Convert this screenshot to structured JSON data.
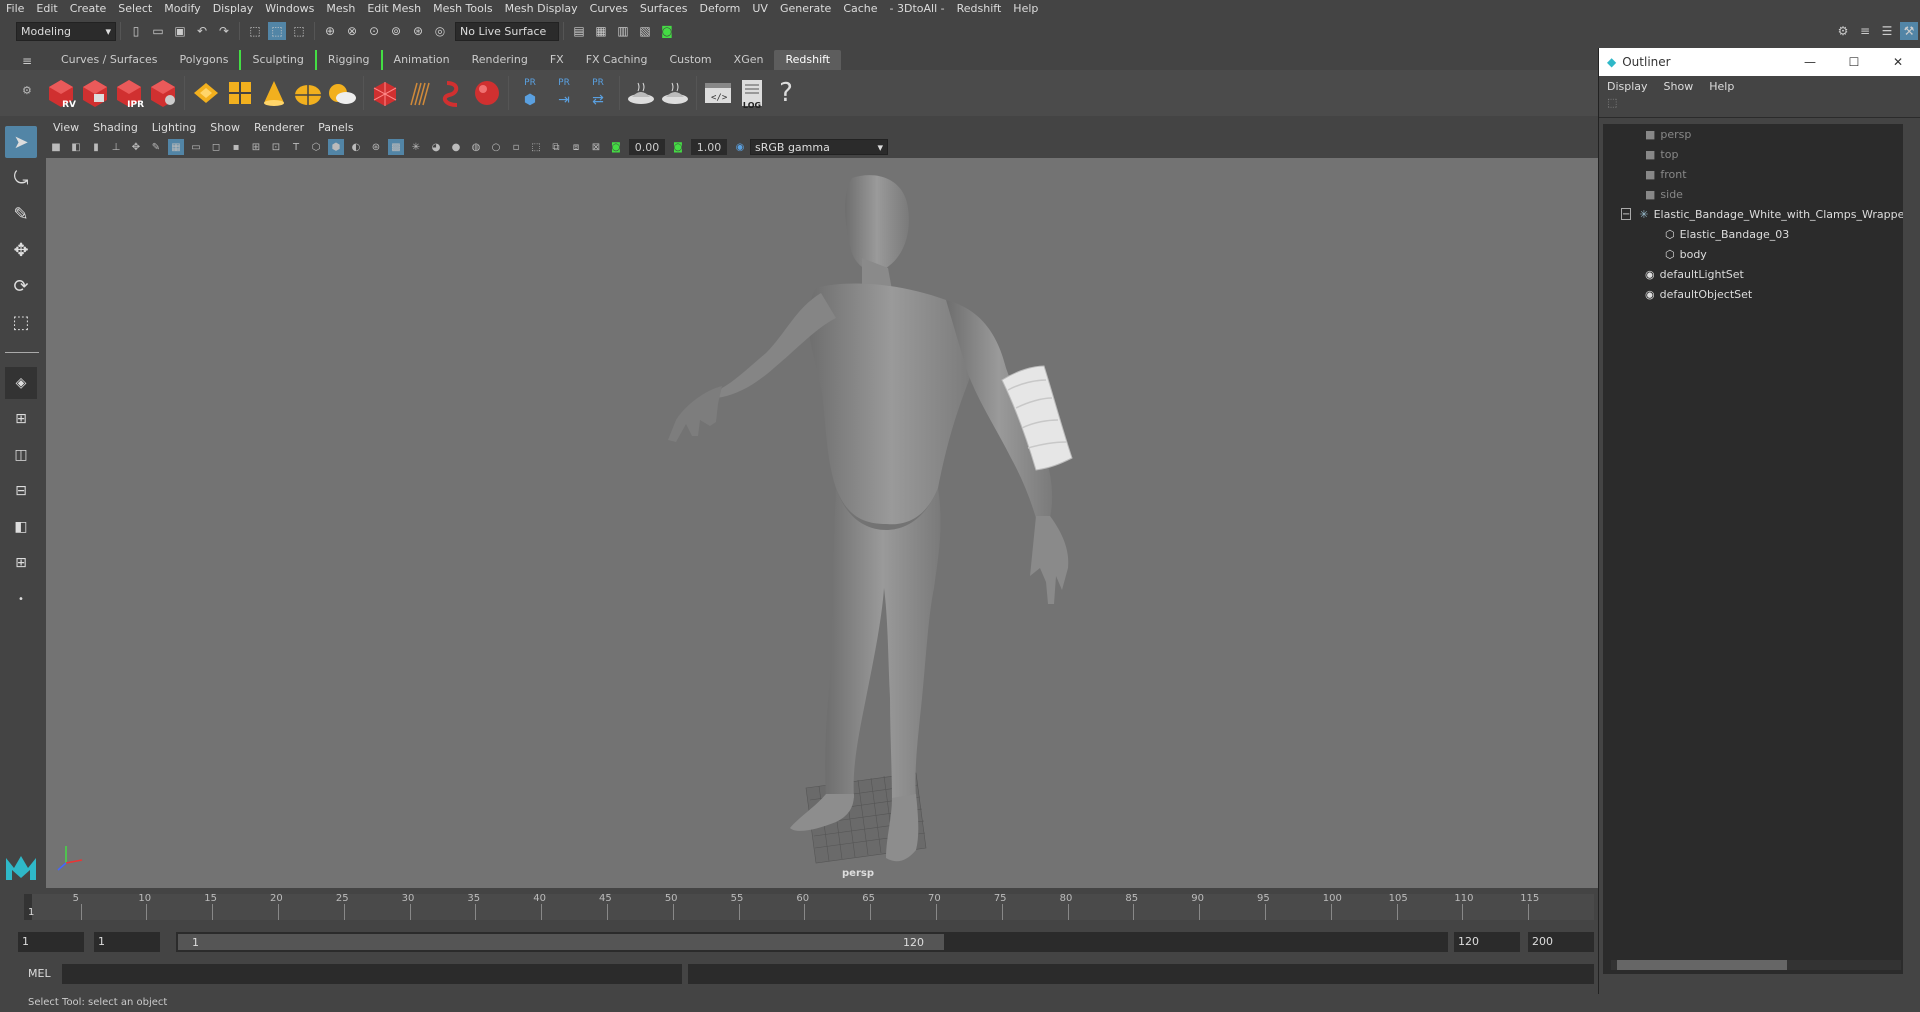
{
  "menubar": {
    "items": [
      "File",
      "Edit",
      "Create",
      "Select",
      "Modify",
      "Display",
      "Windows",
      "Mesh",
      "Edit Mesh",
      "Mesh Tools",
      "Mesh Display",
      "Curves",
      "Surfaces",
      "Deform",
      "UV",
      "Generate",
      "Cache",
      "- 3DtoAll -",
      "Redshift",
      "Help"
    ]
  },
  "status": {
    "mode": "Modeling",
    "live_surface": "No Live Surface"
  },
  "shelf": {
    "tabs": [
      "Curves / Surfaces",
      "Polygons",
      "Sculpting",
      "Rigging",
      "Animation",
      "Rendering",
      "FX",
      "FX Caching",
      "Custom",
      "XGen",
      "Redshift"
    ],
    "active_tab": "Redshift",
    "icon_labels": [
      "RV",
      "IPR",
      "PR",
      "PR",
      "PR",
      "LOG",
      "?"
    ]
  },
  "viewport": {
    "menus": [
      "View",
      "Shading",
      "Lighting",
      "Show",
      "Renderer",
      "Panels"
    ],
    "exposure": "0.00",
    "gamma": "1.00",
    "color_space": "sRGB gamma",
    "camera_label": "persp"
  },
  "timeline": {
    "ticks": [
      "5",
      "10",
      "15",
      "20",
      "25",
      "30",
      "35",
      "40",
      "45",
      "50",
      "55",
      "60",
      "65",
      "70",
      "75",
      "80",
      "85",
      "90",
      "95",
      "100",
      "105",
      "110",
      "115"
    ],
    "current": "1"
  },
  "range": {
    "start_field": "1",
    "start_field2": "1",
    "range_start": "1",
    "range_end": "120",
    "end_field": "120",
    "end_field2": "200"
  },
  "cmdline": {
    "label": "MEL"
  },
  "helpline": {
    "text": "Select Tool: select an object"
  },
  "outliner": {
    "title": "Outliner",
    "menus": [
      "Display",
      "Show",
      "Help"
    ],
    "items": [
      {
        "label": "persp",
        "type": "camera",
        "indent": 0
      },
      {
        "label": "top",
        "type": "camera",
        "indent": 0
      },
      {
        "label": "front",
        "type": "camera",
        "indent": 0
      },
      {
        "label": "side",
        "type": "camera",
        "indent": 0
      },
      {
        "label": "Elastic_Bandage_White_with_Clamps_Wrapped_",
        "type": "group",
        "indent": 0
      },
      {
        "label": "Elastic_Bandage_03",
        "type": "mesh",
        "indent": 1
      },
      {
        "label": "body",
        "type": "mesh",
        "indent": 1
      },
      {
        "label": "defaultLightSet",
        "type": "set",
        "indent": 0
      },
      {
        "label": "defaultObjectSet",
        "type": "set",
        "indent": 0
      }
    ]
  },
  "colors": {
    "panel": "#444444",
    "viewport_bg": "#737373",
    "outliner_list_bg": "#2b2b2b",
    "accent_green": "#44dd44",
    "redshift_red": "#d03030"
  }
}
